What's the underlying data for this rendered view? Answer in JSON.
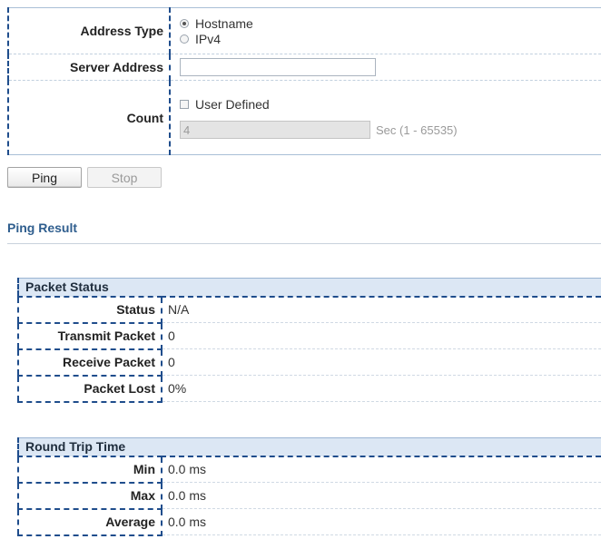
{
  "form": {
    "address_type": {
      "label": "Address Type",
      "options": [
        {
          "label": "Hostname",
          "checked": true
        },
        {
          "label": "IPv4",
          "checked": false
        }
      ]
    },
    "server_address": {
      "label": "Server Address",
      "value": ""
    },
    "count": {
      "label": "Count",
      "user_defined_label": "User Defined",
      "user_defined_checked": false,
      "value": "4",
      "hint": "Sec (1 - 65535)"
    }
  },
  "buttons": {
    "ping": "Ping",
    "stop": "Stop"
  },
  "ping_result": {
    "title": "Ping Result",
    "packet_status": {
      "title": "Packet Status",
      "rows": [
        {
          "label": "Status",
          "value": "N/A"
        },
        {
          "label": "Transmit Packet",
          "value": "0"
        },
        {
          "label": "Receive Packet",
          "value": "0"
        },
        {
          "label": "Packet Lost",
          "value": "0%"
        }
      ]
    },
    "round_trip_time": {
      "title": "Round Trip Time",
      "rows": [
        {
          "label": "Min",
          "value": "0.0 ms"
        },
        {
          "label": "Max",
          "value": "0.0 ms"
        },
        {
          "label": "Average",
          "value": "0.0 ms"
        }
      ]
    }
  },
  "colors": {
    "accent_border": "#1f4d8c",
    "section_title": "#2f5e8e",
    "header_bg": "#dce7f4"
  }
}
